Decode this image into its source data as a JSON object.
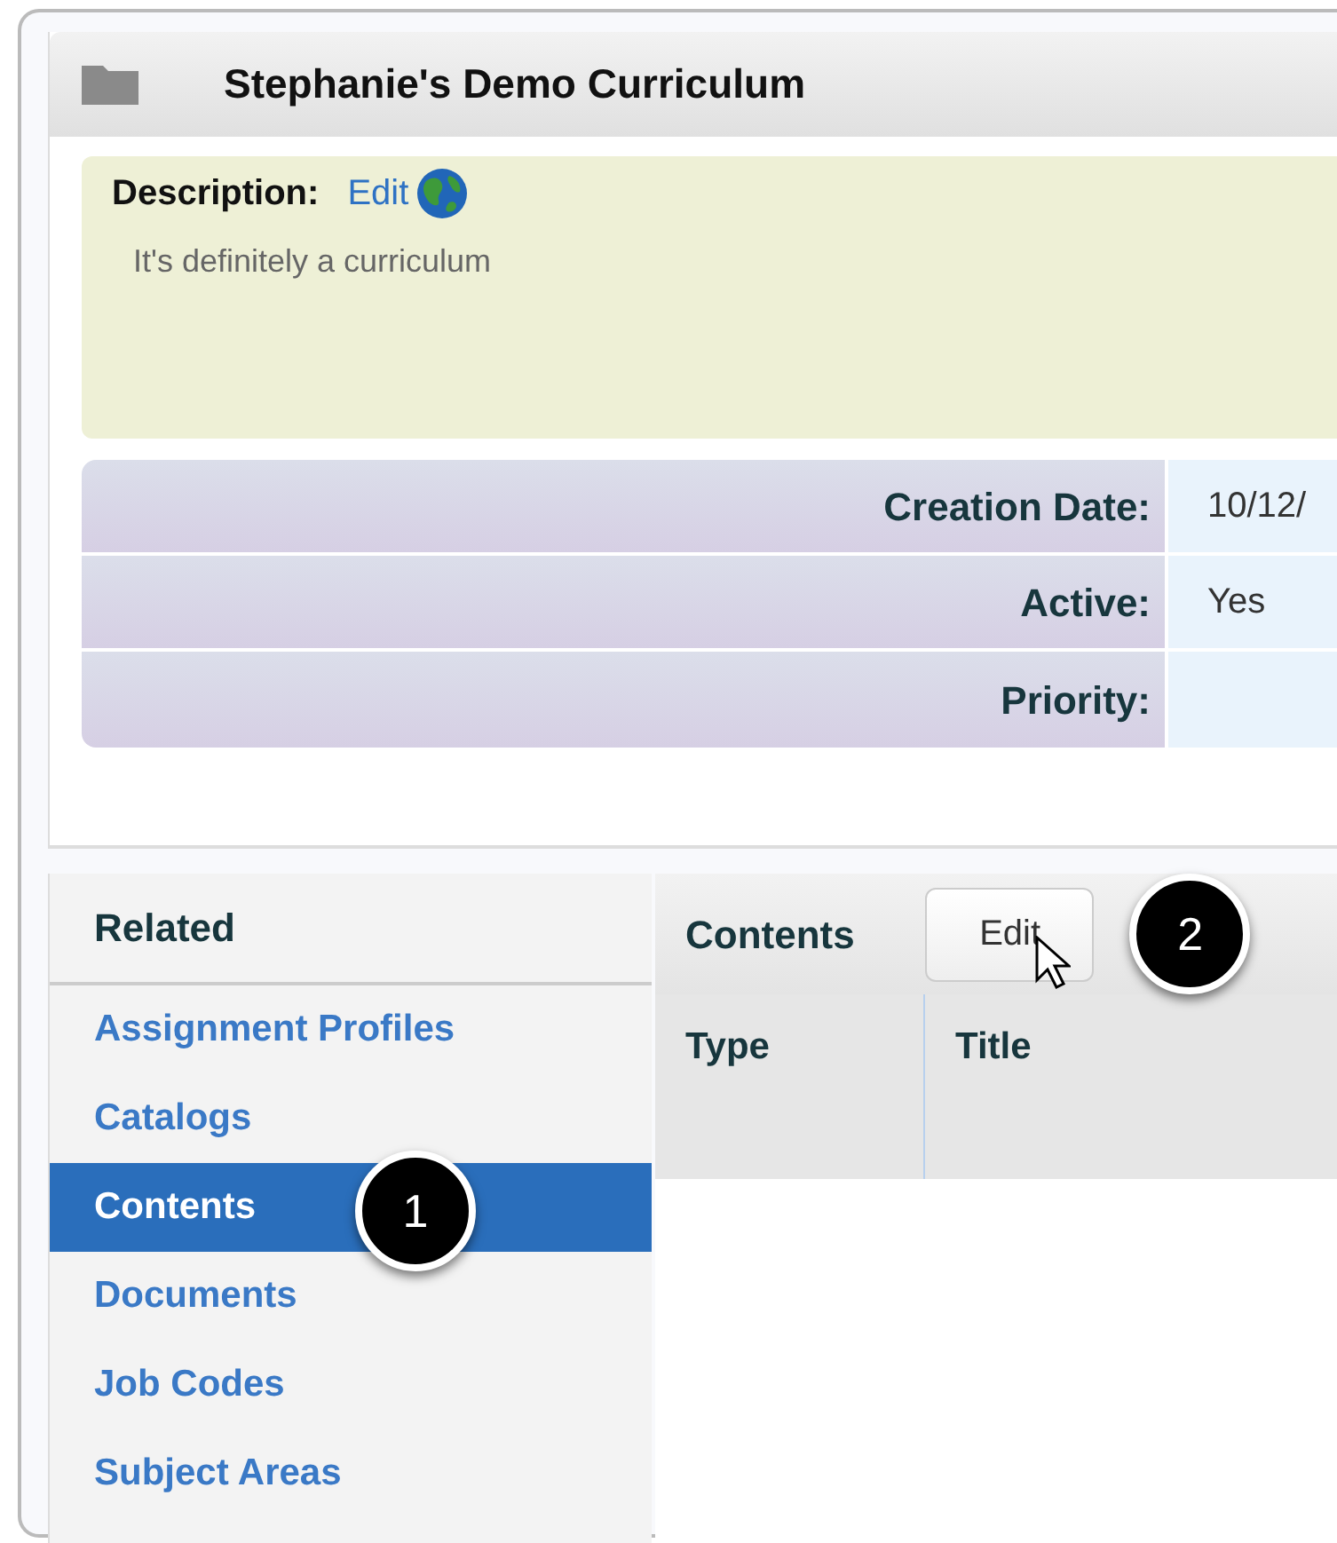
{
  "window": {
    "title": "Stephanie's Demo Curriculum"
  },
  "description": {
    "label": "Description:",
    "edit_link": "Edit",
    "text": "It's definitely a curriculum"
  },
  "properties": [
    {
      "label": "Creation Date:",
      "value": "10/12/"
    },
    {
      "label": "Active:",
      "value": "Yes"
    },
    {
      "label": "Priority:"
    }
  ],
  "related": {
    "title": "Related",
    "items": [
      {
        "label": "Assignment Profiles",
        "selected": false
      },
      {
        "label": "Catalogs",
        "selected": false
      },
      {
        "label": "Contents",
        "selected": true
      },
      {
        "label": "Documents",
        "selected": false
      },
      {
        "label": "Job Codes",
        "selected": false
      },
      {
        "label": "Subject Areas",
        "selected": false
      }
    ]
  },
  "contents": {
    "title": "Contents",
    "edit_button": "Edit",
    "columns": [
      "Type",
      "Title"
    ]
  },
  "callouts": [
    {
      "number": "1"
    },
    {
      "number": "2"
    }
  ]
}
